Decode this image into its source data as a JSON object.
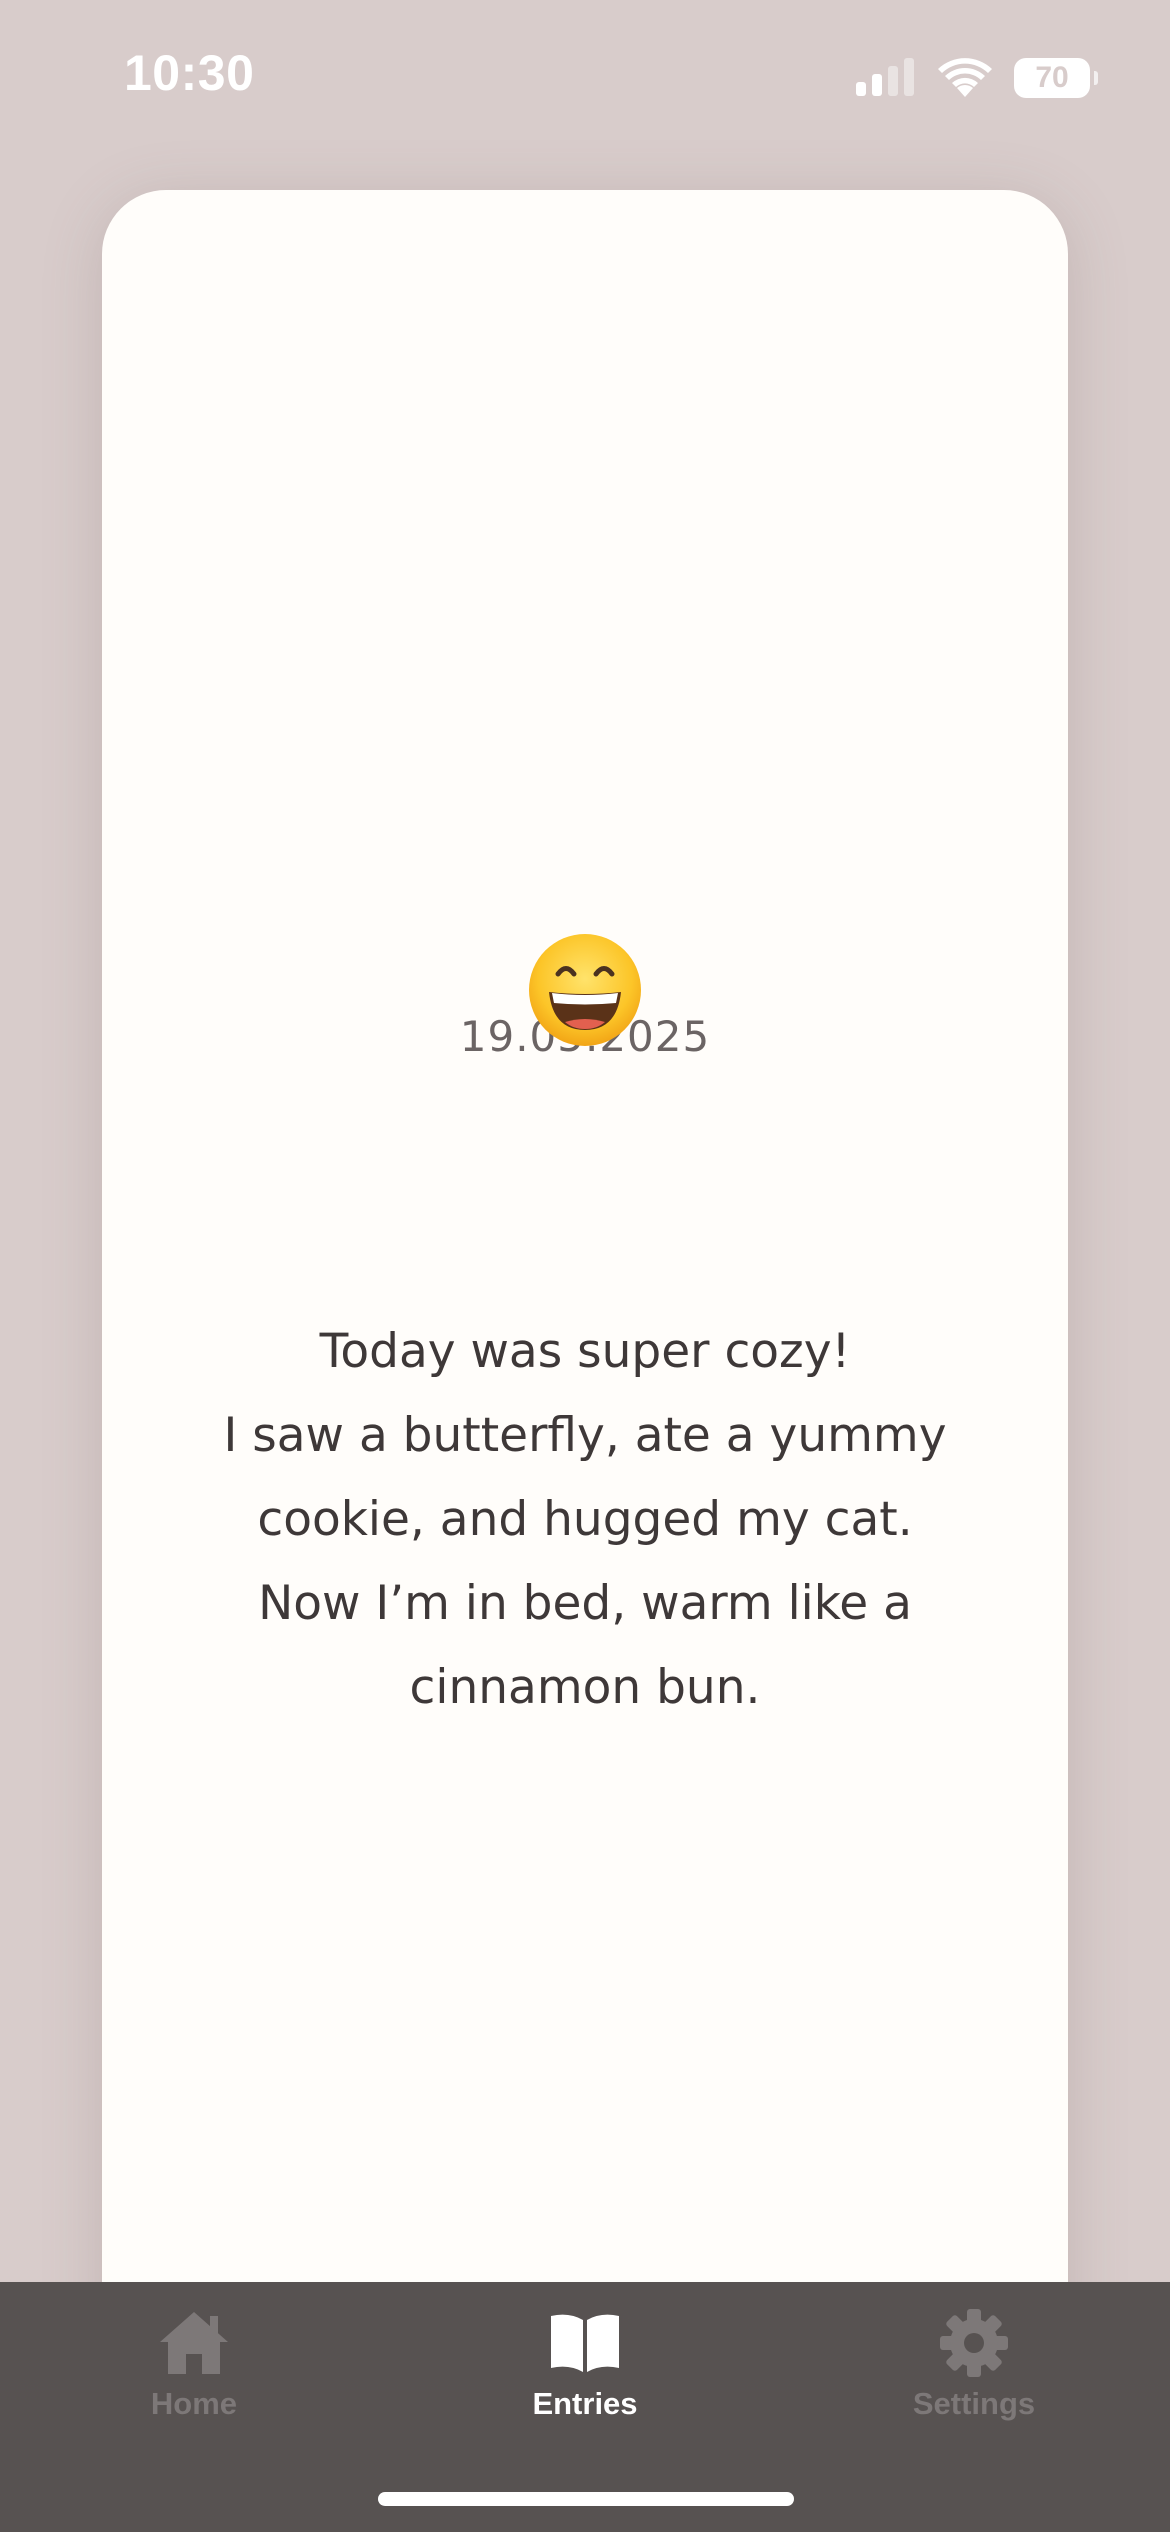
{
  "status_bar": {
    "time": "10:30",
    "battery_level": "70",
    "icons": [
      "signal-icon",
      "wifi-icon",
      "battery-icon"
    ]
  },
  "entry": {
    "date": "19.05.2025",
    "mood_emoji": "grinning-face-with-smiling-eyes",
    "text": "Today was super cozy!\nI saw a butterfly, ate a yummy cookie, and hugged my cat.\nNow I’m in bed, warm like a cinnamon bun."
  },
  "tab_bar": {
    "tabs": [
      {
        "label": "Home",
        "icon": "home-icon",
        "active": false
      },
      {
        "label": "Entries",
        "icon": "book-icon",
        "active": true
      },
      {
        "label": "Settings",
        "icon": "gear-icon",
        "active": false
      }
    ]
  },
  "colors": {
    "background": "#d8cccb",
    "card": "#fffdfa",
    "tab_bar": "#575251",
    "tab_active": "#ffffff",
    "tab_inactive": "#7d7878",
    "text": "#3e3838"
  }
}
